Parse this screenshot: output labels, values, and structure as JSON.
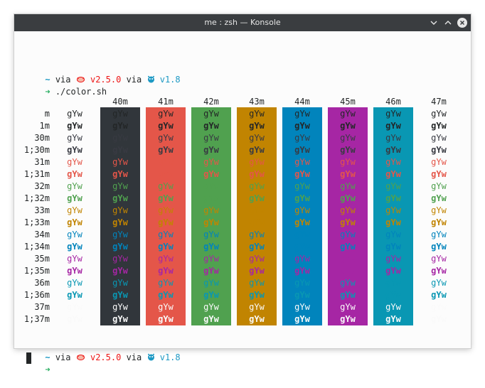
{
  "window": {
    "title": "me : zsh — Konsole",
    "buttons": [
      {
        "name": "minimize-button",
        "icon": "chevron-down-icon"
      },
      {
        "name": "maximize-button",
        "icon": "chevron-up-icon"
      },
      {
        "name": "close-button",
        "icon": "close-icon"
      }
    ]
  },
  "colors": {
    "fg": "#232627",
    "prompt_tilde": "#1d99c4",
    "prompt_via": "#232627",
    "prompt_rust": "#ed1515",
    "prompt_go": "#1d99c4",
    "arrow": "#27ae60",
    "bg_40": "#31363b",
    "bg_41": "#e45649",
    "bg_42": "#50a14f",
    "bg_43": "#c18401",
    "bg_44": "#0184bc",
    "bg_45": "#a626a4",
    "bg_46": "#0997b3",
    "bg_47": "#fafafa",
    "fg_30": "#383a42",
    "fg_31": "#e45649",
    "fg_32": "#50a14f",
    "fg_33": "#c18401",
    "fg_34": "#0184bc",
    "fg_35": "#a626a4",
    "fg_36": "#0997b3",
    "fg_37": "#fafafa"
  },
  "prompt1": {
    "tilde": "~",
    "via1": "via",
    "rust_icon": "crab-icon",
    "rust_version": "v2.5.0",
    "via2": "via",
    "go_icon": "gopher-icon",
    "go_version": "v1.8"
  },
  "command_line": {
    "arrow": "➜",
    "command": "./color.sh"
  },
  "prompt2": {
    "tilde": "~",
    "via1": "via",
    "rust_icon": "crab-icon",
    "rust_version": "v2.5.0",
    "via2": "via",
    "go_icon": "gopher-icon",
    "go_version": "v1.8",
    "arrow": "➜"
  },
  "sample_text": "gYw",
  "columns": [
    "40m",
    "41m",
    "42m",
    "43m",
    "44m",
    "45m",
    "46m",
    "47m"
  ],
  "rows": [
    "m",
    "1m",
    "30m",
    "1;30m",
    "31m",
    "1;31m",
    "32m",
    "1;32m",
    "33m",
    "1;33m",
    "34m",
    "1;34m",
    "35m",
    "1;35m",
    "36m",
    "1;36m",
    "37m",
    "1;37m"
  ]
}
